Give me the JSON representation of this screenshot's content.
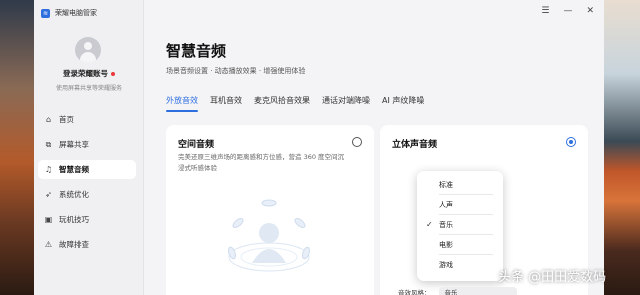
{
  "app": {
    "title": "荣耀电脑管家",
    "logo_glyph": "≋"
  },
  "window_controls": [
    "☰",
    "—",
    "✕"
  ],
  "sidebar": {
    "login": "登录荣耀账号",
    "login_sub": "使用屏幕共享等荣耀服务",
    "items": [
      {
        "label": "首页",
        "icon": "home-icon",
        "glyph": "⌂"
      },
      {
        "label": "屏幕共享",
        "icon": "screen-share-icon",
        "glyph": "⧉"
      },
      {
        "label": "智慧音频",
        "icon": "headphones-icon",
        "glyph": "♫"
      },
      {
        "label": "系统优化",
        "icon": "rocket-icon",
        "glyph": "➶"
      },
      {
        "label": "玩机技巧",
        "icon": "tips-icon",
        "glyph": "▣"
      },
      {
        "label": "故障排查",
        "icon": "troubleshoot-icon",
        "glyph": "⚠"
      }
    ]
  },
  "main": {
    "title": "智慧音频",
    "subtitle": "场景音频设置 · 动态播放效果 · 增强使用体验",
    "tabs": [
      "外放音效",
      "耳机音效",
      "麦克风拾音效果",
      "通话对端降噪",
      "AI 声纹降噪"
    ]
  },
  "cards": {
    "spatial": {
      "title": "空间音频",
      "desc": "完美还原三维声场的距离感和方位感，营造 360 度空间沉浸式听感体验",
      "selected": false
    },
    "stereo": {
      "title": "立体声音频",
      "selected": true
    }
  },
  "dropdown": {
    "options": [
      "标准",
      "人声",
      "音乐",
      "电影",
      "游戏"
    ],
    "selected": "音乐"
  },
  "style_row": {
    "label": "音效风格：",
    "value": "音乐"
  },
  "watermark": "头条 @田田爱数码",
  "colors": {
    "accent": "#2e6fe0",
    "window_bg": "#f4f4f6"
  }
}
